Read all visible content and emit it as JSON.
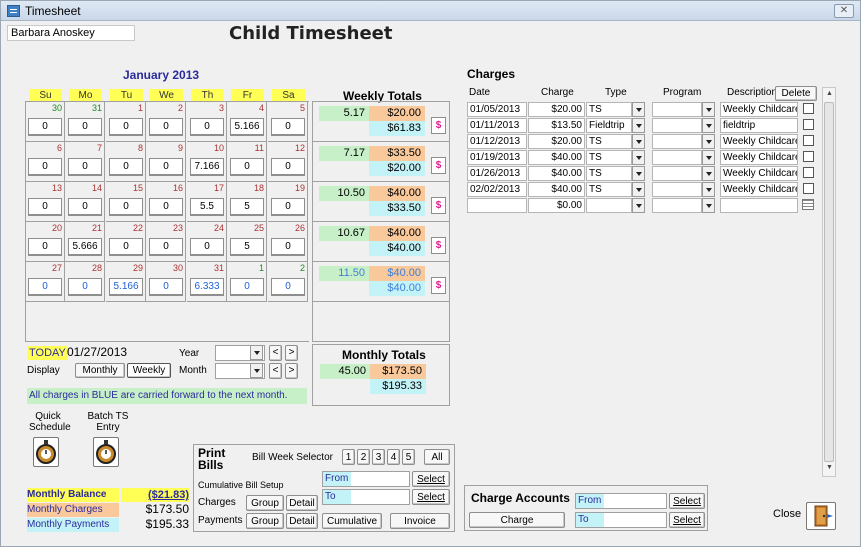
{
  "window": {
    "title": "Timesheet"
  },
  "child_name": "Barbara Anoskey",
  "page_title": "Child Timesheet",
  "calendar": {
    "month_label": "January 2013",
    "days": [
      "Su",
      "Mo",
      "Tu",
      "We",
      "Th",
      "Fr",
      "Sa"
    ],
    "weeks": [
      [
        {
          "d": "30",
          "h": "0",
          "g": true
        },
        {
          "d": "31",
          "h": "0",
          "g": true
        },
        {
          "d": "1",
          "h": "0"
        },
        {
          "d": "2",
          "h": "0"
        },
        {
          "d": "3",
          "h": "0"
        },
        {
          "d": "4",
          "h": "5.166"
        },
        {
          "d": "5",
          "h": "0"
        }
      ],
      [
        {
          "d": "6",
          "h": "0"
        },
        {
          "d": "7",
          "h": "0"
        },
        {
          "d": "8",
          "h": "0"
        },
        {
          "d": "9",
          "h": "0"
        },
        {
          "d": "10",
          "h": "7.166"
        },
        {
          "d": "11",
          "h": "0"
        },
        {
          "d": "12",
          "h": "0"
        }
      ],
      [
        {
          "d": "13",
          "h": "0"
        },
        {
          "d": "14",
          "h": "0"
        },
        {
          "d": "15",
          "h": "0"
        },
        {
          "d": "16",
          "h": "0"
        },
        {
          "d": "17",
          "h": "5.5"
        },
        {
          "d": "18",
          "h": "5"
        },
        {
          "d": "19",
          "h": "0"
        }
      ],
      [
        {
          "d": "20",
          "h": "0"
        },
        {
          "d": "21",
          "h": "5.666"
        },
        {
          "d": "22",
          "h": "0"
        },
        {
          "d": "23",
          "h": "0"
        },
        {
          "d": "24",
          "h": "0"
        },
        {
          "d": "25",
          "h": "5"
        },
        {
          "d": "26",
          "h": "0"
        }
      ],
      [
        {
          "d": "27",
          "h": "0",
          "b": true
        },
        {
          "d": "28",
          "h": "0",
          "b": true
        },
        {
          "d": "29",
          "h": "5.166",
          "b": true
        },
        {
          "d": "30",
          "h": "0",
          "b": true
        },
        {
          "d": "31",
          "h": "6.333",
          "b": true
        },
        {
          "d": "1",
          "h": "0",
          "b": true,
          "g": true
        },
        {
          "d": "2",
          "h": "0",
          "b": true,
          "g": true
        }
      ]
    ]
  },
  "weekly": {
    "title": "Weekly Totals",
    "rows": [
      {
        "hours": "5.17",
        "charge": "$20.00",
        "payment": "$61.83"
      },
      {
        "hours": "7.17",
        "charge": "$33.50",
        "payment": "$20.00"
      },
      {
        "hours": "10.50",
        "charge": "$40.00",
        "payment": "$33.50"
      },
      {
        "hours": "10.67",
        "charge": "$40.00",
        "payment": "$40.00"
      },
      {
        "hours": "11.50",
        "charge": "$40.00",
        "payment": "$40.00",
        "blue": true
      }
    ],
    "dollar_label": "$"
  },
  "monthly": {
    "title": "Monthly Totals",
    "hours": "45.00",
    "charge": "$173.50",
    "payment": "$195.33"
  },
  "today": {
    "label": "TODAY",
    "date": "01/27/2013"
  },
  "display": {
    "label": "Display",
    "monthly": "Monthly",
    "weekly": "Weekly"
  },
  "year_label": "Year",
  "month_label": "Month",
  "nav": {
    "prev": "<",
    "next": ">"
  },
  "blue_note": "All charges in BLUE are carried forward to the next month.",
  "quick_schedule": "Quick\nSchedule",
  "batch_ts": "Batch TS\nEntry",
  "balance": {
    "label": "Monthly Balance",
    "value": "($21.83)",
    "charges_label": "Monthly Charges",
    "charges_value": "$173.50",
    "payments_label": "Monthly Payments",
    "payments_value": "$195.33"
  },
  "print": {
    "title": "Print\nBills",
    "bill_week_selector": "Bill Week Selector",
    "weeks": [
      "1",
      "2",
      "3",
      "4",
      "5"
    ],
    "all": "All",
    "cumulative_setup": "Cumulative Bill Setup",
    "charges": "Charges",
    "payments": "Payments",
    "group": "Group",
    "detail": "Detail",
    "cumulative": "Cumulative",
    "invoice": "Invoice",
    "from": "From",
    "to": "To",
    "select": "Select"
  },
  "charges": {
    "title": "Charges",
    "headers": {
      "date": "Date",
      "charge": "Charge",
      "type": "Type",
      "program": "Program",
      "description": "Description"
    },
    "delete": "Delete",
    "rows": [
      {
        "date": "01/05/2013",
        "charge": "$20.00",
        "type": "TS",
        "desc": "Weekly Childcare"
      },
      {
        "date": "01/11/2013",
        "charge": "$13.50",
        "type": "Fieldtrip",
        "desc": "fieldtrip"
      },
      {
        "date": "01/12/2013",
        "charge": "$20.00",
        "type": "TS",
        "desc": "Weekly Childcare"
      },
      {
        "date": "01/19/2013",
        "charge": "$40.00",
        "type": "TS",
        "desc": "Weekly Childcare"
      },
      {
        "date": "01/26/2013",
        "charge": "$40.00",
        "type": "TS",
        "desc": "Weekly Childcare"
      },
      {
        "date": "02/02/2013",
        "charge": "$40.00",
        "type": "TS",
        "desc": "Weekly Childcare"
      },
      {
        "date": "",
        "charge": "$0.00",
        "type": "",
        "desc": ""
      }
    ]
  },
  "charge_accounts": {
    "title": "Charge Accounts",
    "charge": "Charge",
    "from": "From",
    "to": "To",
    "select": "Select"
  },
  "close": "Close",
  "colors": {
    "yellow": "#ffff55",
    "green": "#c8f0c8",
    "orange": "#f9c99b",
    "cyan": "#c3f3f7",
    "blue": "#1f5fd6",
    "magenta": "#e01c8d"
  }
}
